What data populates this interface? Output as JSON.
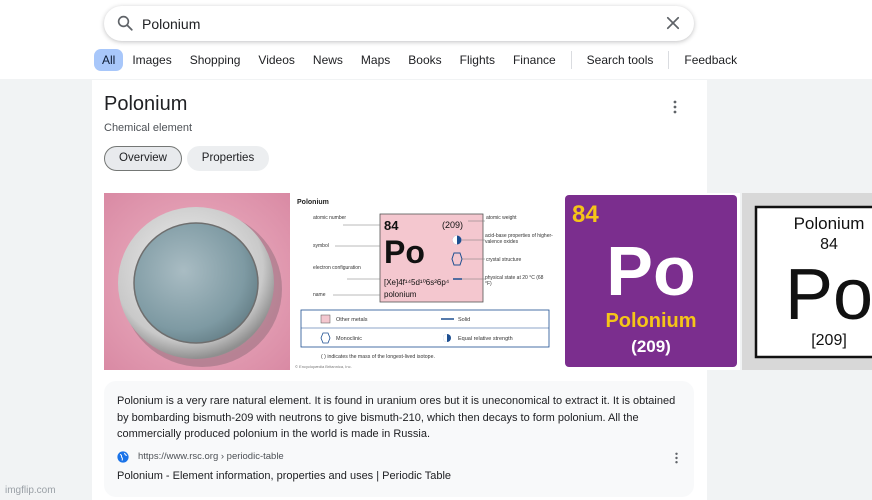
{
  "search": {
    "query": "Polonium"
  },
  "tabs": [
    "All",
    "Images",
    "Shopping",
    "Videos",
    "News",
    "Maps",
    "Books",
    "Flights",
    "Finance"
  ],
  "search_tools": "Search tools",
  "feedback": "Feedback",
  "panel": {
    "title": "Polonium",
    "subtitle": "Chemical element",
    "tab_overview": "Overview",
    "tab_properties": "Properties"
  },
  "images": {
    "diagram": {
      "heading": "Polonium",
      "atomic_number": "84",
      "symbol": "Po",
      "weight": "(209)",
      "configuration": "[Xe]4f¹⁴5d¹⁰6s²6p⁴",
      "name": "polonium",
      "labels_left": [
        "atomic number",
        "symbol",
        "electron configuration",
        "name"
      ],
      "labels_right": [
        "atomic weight",
        "acid-base properties of higher-valence oxides",
        "crystal structure",
        "physical state at 20 °C (68 °F)"
      ],
      "legend": [
        "Other metals",
        "Solid",
        "Monoclinic",
        "Equal relative strength"
      ],
      "footnote": "( ) indicates the mass of the longest-lived isotope.",
      "credit": "© Encyclopædia Britannica, Inc."
    },
    "tile": {
      "number": "84",
      "symbol": "Po",
      "name": "Polonium",
      "mass": "(209)",
      "bg": "#7b2e8e",
      "accent": "#f5c518"
    },
    "card4": {
      "name": "Polonium",
      "number": "84",
      "symbol": "Po",
      "mass": "[209]"
    }
  },
  "result": {
    "snippet": "Polonium is a very rare natural element. It is found in uranium ores but it is uneconomical to extract it. It is obtained by bombarding bismuth-209 with neutrons to give bismuth-210, which then decays to form polonium. All the commercially produced polonium in the world is made in Russia.",
    "url": "https://www.rsc.org › periodic-table",
    "title": "Polonium - Element information, properties and uses | Periodic Table"
  },
  "watermark": "imgflip.com",
  "colors": {
    "accent": "#a8c7fa",
    "link_icon": "#1a73e8"
  }
}
